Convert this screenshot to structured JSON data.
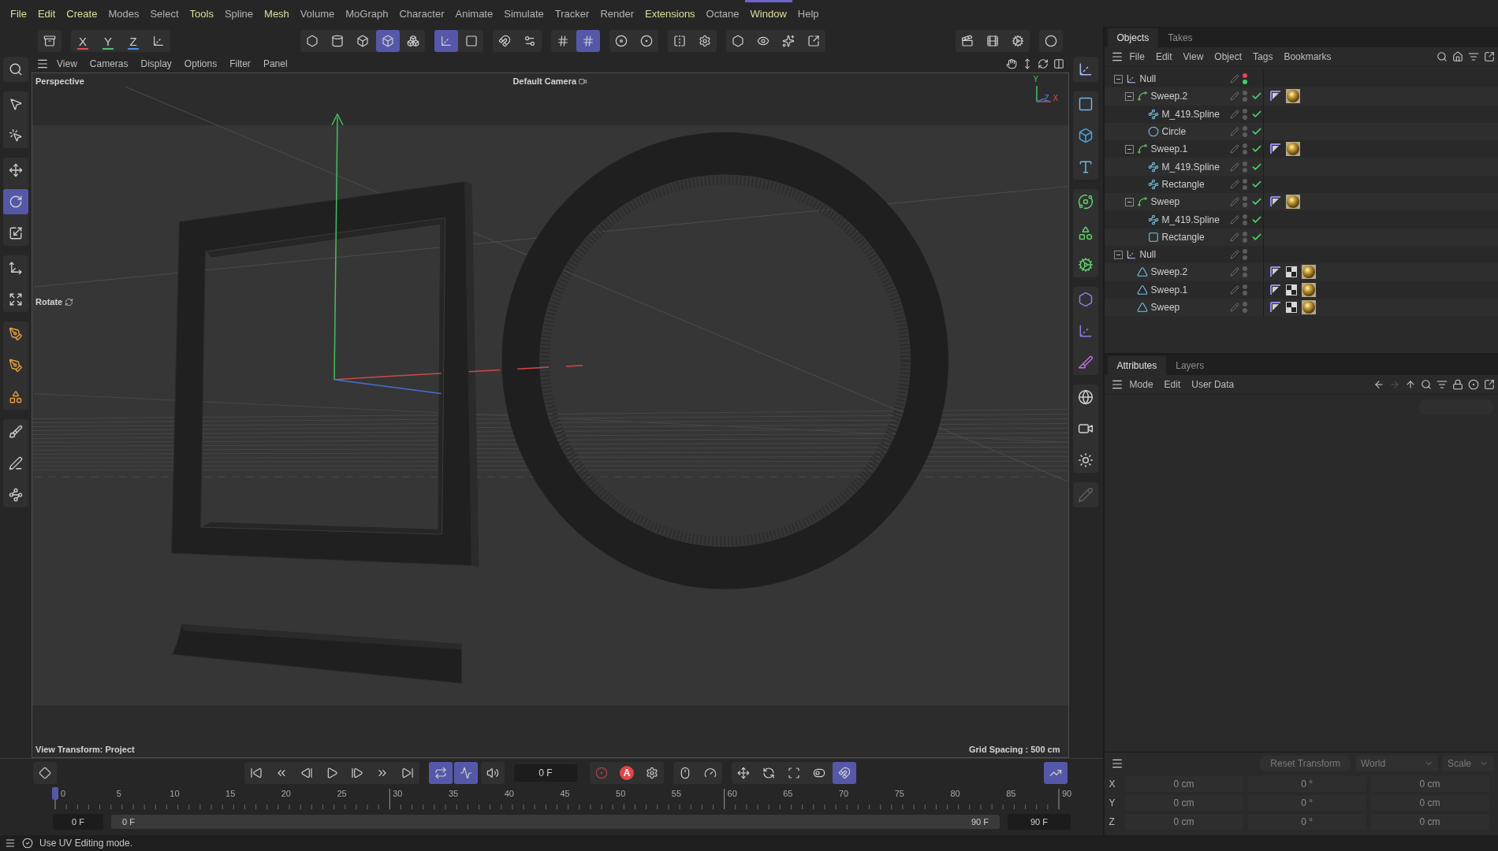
{
  "menu": [
    {
      "label": "File",
      "color": "#dede9c",
      "selected": false
    },
    {
      "label": "Edit",
      "color": "#dede9c",
      "selected": false
    },
    {
      "label": "Create",
      "color": "#dede9c",
      "selected": false
    },
    {
      "label": "Modes",
      "color": "#b4b4b4",
      "selected": false
    },
    {
      "label": "Select",
      "color": "#b4b4b4",
      "selected": false
    },
    {
      "label": "Tools",
      "color": "#dede9c",
      "selected": false
    },
    {
      "label": "Spline",
      "color": "#b4b4b4",
      "selected": false
    },
    {
      "label": "Mesh",
      "color": "#dede9c",
      "selected": false
    },
    {
      "label": "Volume",
      "color": "#b4b4b4",
      "selected": false
    },
    {
      "label": "MoGraph",
      "color": "#b4b4b4",
      "selected": false
    },
    {
      "label": "Character",
      "color": "#b4b4b4",
      "selected": false
    },
    {
      "label": "Animate",
      "color": "#b4b4b4",
      "selected": false
    },
    {
      "label": "Simulate",
      "color": "#b4b4b4",
      "selected": false
    },
    {
      "label": "Tracker",
      "color": "#b4b4b4",
      "selected": false
    },
    {
      "label": "Render",
      "color": "#b4b4b4",
      "selected": false
    },
    {
      "label": "Extensions",
      "color": "#dede9c",
      "selected": false
    },
    {
      "label": "Octane",
      "color": "#b4b4b4",
      "selected": false
    },
    {
      "label": "Window",
      "color": "#dede9c",
      "selected": true
    },
    {
      "label": "Help",
      "color": "#b4b4b4",
      "selected": false
    }
  ],
  "toolbar": [
    {
      "kind": "icon",
      "selected": false
    },
    {
      "kind": "text",
      "label": "X",
      "color": "#e0504f",
      "selected": false
    },
    {
      "kind": "text",
      "label": "Y",
      "color": "#4fc06a",
      "selected": false
    },
    {
      "kind": "text",
      "label": "Z",
      "color": "#4f8fe0",
      "selected": false
    },
    {
      "kind": "icon",
      "selected": false
    },
    {
      "kind": "icon",
      "selected": false
    },
    {
      "kind": "icon",
      "selected": false
    },
    {
      "kind": "icon",
      "selected": false
    },
    {
      "kind": "icon",
      "selected": true
    },
    {
      "kind": "icon",
      "selected": false
    },
    {
      "kind": "icon",
      "selected": true
    },
    {
      "kind": "icon",
      "selected": false
    },
    {
      "kind": "icon",
      "selected": false
    },
    {
      "kind": "icon",
      "selected": false
    },
    {
      "kind": "icon",
      "selected": false
    },
    {
      "kind": "icon",
      "selected": true
    },
    {
      "kind": "icon",
      "selected": false
    },
    {
      "kind": "icon",
      "selected": false
    },
    {
      "kind": "icon",
      "selected": false
    },
    {
      "kind": "icon",
      "selected": false
    },
    {
      "kind": "icon",
      "selected": false
    },
    {
      "kind": "icon",
      "selected": false
    },
    {
      "kind": "icon",
      "selected": false
    },
    {
      "kind": "icon",
      "selected": false
    },
    {
      "kind": "icon",
      "selected": false
    },
    {
      "kind": "icon",
      "selected": false
    },
    {
      "kind": "icon",
      "selected": false
    },
    {
      "kind": "icon",
      "selected": false
    }
  ],
  "tools": [
    {
      "selected": false
    },
    {
      "selected": false
    },
    {
      "selected": false
    },
    {
      "selected": false
    },
    {
      "selected": true
    },
    {
      "selected": false
    },
    {
      "selected": false
    },
    {
      "selected": false
    },
    {
      "selected": false
    },
    {
      "selected": false
    },
    {
      "selected": false
    },
    {
      "selected": false
    },
    {
      "selected": false
    },
    {
      "selected": false
    }
  ],
  "object_palette": [
    {
      "disabled": false
    },
    {
      "disabled": false
    },
    {
      "disabled": false
    },
    {
      "disabled": false
    },
    {
      "disabled": false
    },
    {
      "disabled": false
    },
    {
      "disabled": false
    },
    {
      "disabled": false
    },
    {
      "disabled": false
    },
    {
      "disabled": false
    },
    {
      "disabled": false
    },
    {
      "disabled": false
    },
    {
      "disabled": false
    },
    {
      "disabled": true
    }
  ],
  "viewport": {
    "menu": [
      "View",
      "Cameras",
      "Display",
      "Options",
      "Filter",
      "Panel"
    ],
    "view_name": "Perspective",
    "camera": "Default Camera",
    "tool_hint": "Rotate",
    "axis_indicator": {
      "y": "Y",
      "z": "Z",
      "x": "X"
    },
    "view_transform": "View Transform: Project",
    "grid_spacing": "Grid Spacing : 500 cm"
  },
  "timeline": {
    "transport": [
      {
        "kind": "icon",
        "selected": false
      },
      {
        "kind": "icon",
        "selected": false
      },
      {
        "kind": "icon",
        "selected": false
      },
      {
        "kind": "icon",
        "selected": false
      },
      {
        "kind": "icon",
        "selected": false
      },
      {
        "kind": "icon",
        "selected": false
      },
      {
        "kind": "icon",
        "selected": false
      },
      {
        "kind": "icon",
        "selected": false
      },
      {
        "kind": "icon",
        "selected": true
      },
      {
        "kind": "icon",
        "selected": true
      },
      {
        "kind": "icon",
        "selected": false
      },
      {
        "kind": "icon",
        "selected": false
      },
      {
        "kind": "text",
        "label": "A",
        "selected": false
      },
      {
        "kind": "icon",
        "selected": false
      },
      {
        "kind": "icon",
        "selected": false
      },
      {
        "kind": "icon",
        "selected": false
      },
      {
        "kind": "icon",
        "selected": false
      },
      {
        "kind": "icon",
        "selected": false
      },
      {
        "kind": "icon",
        "selected": false
      },
      {
        "kind": "icon",
        "selected": false
      },
      {
        "kind": "icon",
        "selected": true
      },
      {
        "kind": "icon",
        "selected": true
      }
    ],
    "frame": "0 F",
    "ruler": [
      "0",
      "5",
      "10",
      "15",
      "20",
      "25",
      "30",
      "35",
      "40",
      "45",
      "50",
      "55",
      "60",
      "65",
      "70",
      "75",
      "80",
      "85",
      "90"
    ],
    "playhead": {
      "level": 0
    },
    "range_start_field": "0 F",
    "range_start": "0 F",
    "range_end": "90 F",
    "range_end_field": "90 F"
  },
  "objects": {
    "tabs": [
      {
        "label": "Objects",
        "selected": true
      },
      {
        "label": "Takes",
        "selected": false
      }
    ],
    "menu": [
      "File",
      "Edit",
      "View",
      "Object",
      "Tags",
      "Bookmarks"
    ],
    "tree": [
      {
        "name": "Null",
        "kind": "null",
        "expanded": true,
        "check": false,
        "editor_off": true,
        "render_on": true,
        "children": [
          {
            "name": "Sweep.2",
            "kind": "sweep",
            "expanded": true,
            "check": true,
            "editor_off": false,
            "render_on": false,
            "tags": [
              {
                "kind": "compositing"
              },
              {
                "kind": "material"
              }
            ],
            "children": [
              {
                "name": "M_419.Spline",
                "kind": "spline",
                "check": true,
                "editor_off": false,
                "render_on": false
              },
              {
                "name": "Circle",
                "kind": "circle",
                "check": true,
                "editor_off": false,
                "render_on": false
              }
            ]
          },
          {
            "name": "Sweep.1",
            "kind": "sweep",
            "expanded": true,
            "check": true,
            "editor_off": false,
            "render_on": false,
            "tags": [
              {
                "kind": "compositing"
              },
              {
                "kind": "material"
              }
            ],
            "children": [
              {
                "name": "M_419.Spline",
                "kind": "spline",
                "check": true,
                "editor_off": false,
                "render_on": false
              },
              {
                "name": "Rectangle",
                "kind": "spline",
                "check": true,
                "editor_off": false,
                "render_on": false
              }
            ]
          },
          {
            "name": "Sweep",
            "kind": "sweep",
            "expanded": true,
            "check": true,
            "editor_off": false,
            "render_on": false,
            "tags": [
              {
                "kind": "compositing"
              },
              {
                "kind": "material"
              }
            ],
            "children": [
              {
                "name": "M_419.Spline",
                "kind": "spline",
                "check": true,
                "editor_off": false,
                "render_on": false
              },
              {
                "name": "Rectangle",
                "kind": "rectangle",
                "check": true,
                "editor_off": false,
                "render_on": false
              }
            ]
          }
        ]
      },
      {
        "name": "Null",
        "kind": "null",
        "expanded": true,
        "check": false,
        "editor_off": false,
        "render_on": false,
        "children": [
          {
            "name": "Sweep.2",
            "kind": "polygon",
            "check": false,
            "editor_off": false,
            "render_on": false,
            "tags": [
              {
                "kind": "compositing"
              },
              {
                "kind": "uv"
              },
              {
                "kind": "material"
              }
            ]
          },
          {
            "name": "Sweep.1",
            "kind": "polygon",
            "check": false,
            "editor_off": false,
            "render_on": false,
            "tags": [
              {
                "kind": "compositing"
              },
              {
                "kind": "uv"
              },
              {
                "kind": "material"
              }
            ]
          },
          {
            "name": "Sweep",
            "kind": "polygon",
            "check": false,
            "editor_off": false,
            "render_on": false,
            "tags": [
              {
                "kind": "compositing"
              },
              {
                "kind": "uv"
              },
              {
                "kind": "material"
              }
            ]
          }
        ]
      }
    ]
  },
  "attributes": {
    "tabs": [
      {
        "label": "Attributes",
        "selected": true
      },
      {
        "label": "Layers",
        "selected": false
      }
    ],
    "menu": [
      "Mode",
      "Edit",
      "User Data"
    ]
  },
  "coordinates": {
    "reset": "Reset Transform",
    "space": "World",
    "mode": "Scale",
    "rows": [
      {
        "axis": "X",
        "values": [
          "0 cm",
          "0 °",
          "0 cm"
        ]
      },
      {
        "axis": "Y",
        "values": [
          "0 cm",
          "0 °",
          "0 cm"
        ]
      },
      {
        "axis": "Z",
        "values": [
          "0 cm",
          "0 °",
          "0 cm"
        ]
      }
    ]
  },
  "status": "Use UV Editing mode."
}
